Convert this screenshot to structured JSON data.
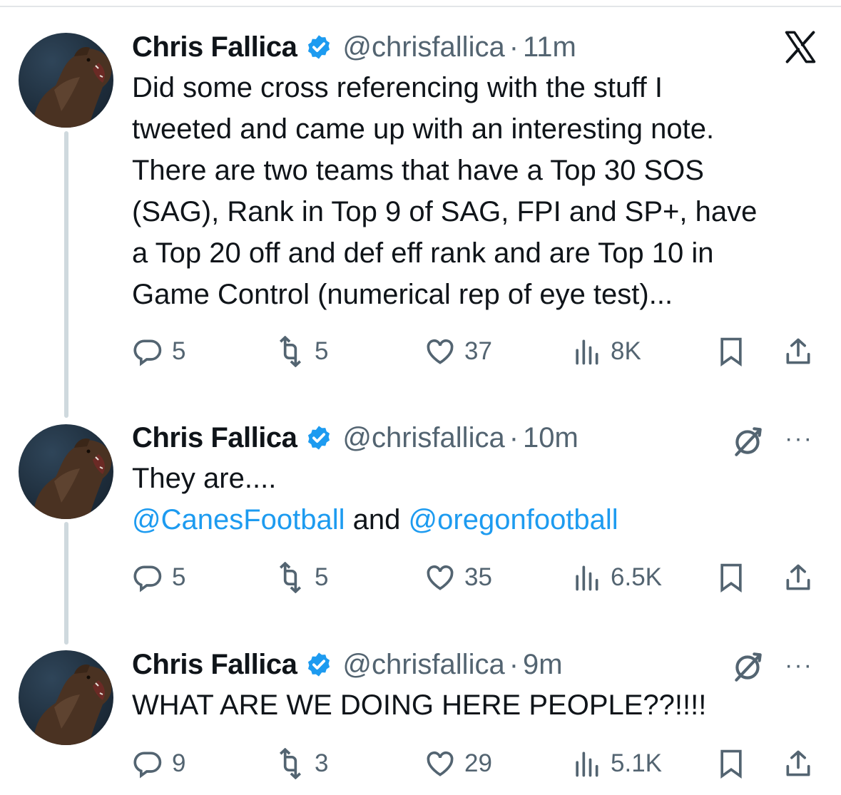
{
  "tweets": [
    {
      "author": "Chris Fallica",
      "handle": "@chrisfallica",
      "separator": "·",
      "time": "11m",
      "text_lines": [
        "Did some cross referencing with the stuff I",
        "tweeted and came up with an interesting note.",
        "There are two teams that have a Top 30 SOS",
        "(SAG), Rank in Top 9 of SAG, FPI and SP+, have",
        "a Top 20 off and def eff rank and are Top 10 in",
        "Game Control (numerical rep of eye test)..."
      ],
      "replies": "5",
      "retweets": "5",
      "likes": "37",
      "views": "8K"
    },
    {
      "author": "Chris Fallica",
      "handle": "@chrisfallica",
      "separator": "·",
      "time": "10m",
      "text_line1": "They are....",
      "mention1": "@CanesFootball",
      "conjunction": "and",
      "mention2": "@oregonfootball",
      "more": "···",
      "replies": "5",
      "retweets": "5",
      "likes": "35",
      "views": "6.5K"
    },
    {
      "author": "Chris Fallica",
      "handle": "@chrisfallica",
      "separator": "·",
      "time": "9m",
      "text": "WHAT ARE WE DOING HERE PEOPLE??!!!!",
      "more": "···",
      "replies": "9",
      "retweets": "3",
      "likes": "29",
      "views": "5.1K"
    }
  ],
  "icons": {
    "brand": "x-logo-icon",
    "verified": "verified-badge-icon",
    "reply": "reply-icon",
    "retweet": "retweet-icon",
    "like": "heart-icon",
    "views": "views-icon",
    "bookmark": "bookmark-icon",
    "share": "share-icon",
    "grok": "grok-icon"
  },
  "colors": {
    "link": "#1d9bf0",
    "verified": "#1d9bf0",
    "secondary_text": "#536471",
    "thread_line": "#cfd9de"
  }
}
